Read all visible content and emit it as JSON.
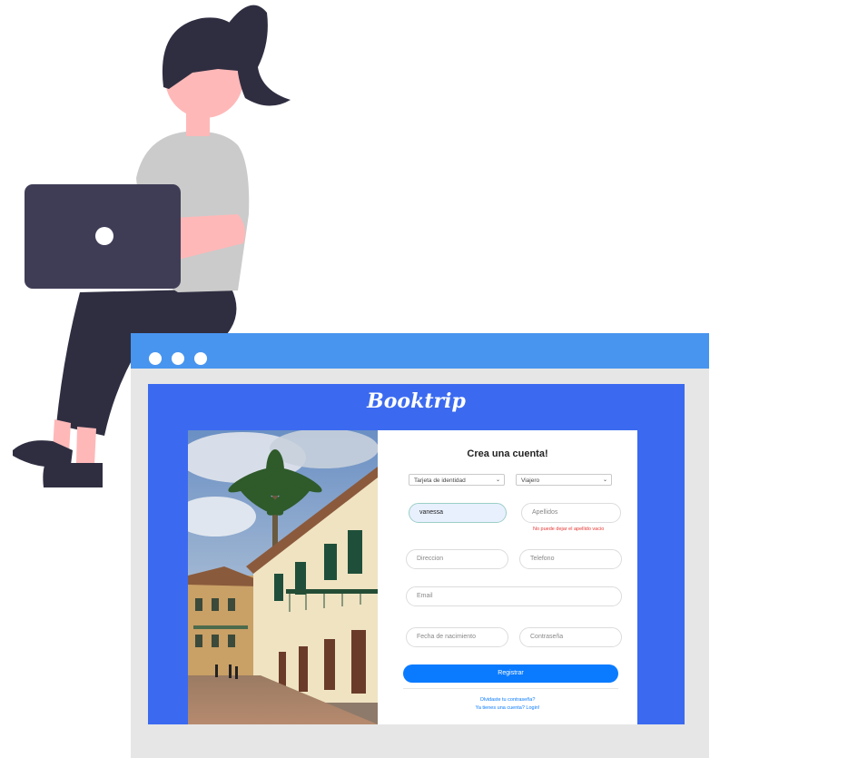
{
  "brand": "Booktrip",
  "form": {
    "title": "Crea una cuenta!",
    "document_type": "Tarjeta de identidad",
    "user_type": "Viajero",
    "name_value": "vanessa",
    "lastname_placeholder": "Apellidos",
    "lastname_error": "No puede dejar el apellido vacio",
    "address_placeholder": "Direccion",
    "phone_placeholder": "Telefono",
    "email_placeholder": "Email",
    "birthdate_placeholder": "Fecha de nacimiento",
    "password_placeholder": "Contraseña",
    "register_label": "Registrar",
    "forgot_link": "Olvidaste tu contraseña?",
    "login_link": "Ya tienes una cuenta? Login!"
  },
  "icons": {
    "window_dots": [
      "window-dot-icon",
      "window-dot-icon",
      "window-dot-icon"
    ],
    "select_arrow": "chevron-down-icon"
  },
  "colors": {
    "browser_bar": "#4895ef",
    "viewport_bg": "#3b6af0",
    "primary_button": "#0a7bff",
    "error": "#e53935",
    "laptop": "#3f3d56",
    "hair_pants": "#2f2e41",
    "skin": "#ffb8b8",
    "shirt": "#cbcbcb"
  }
}
